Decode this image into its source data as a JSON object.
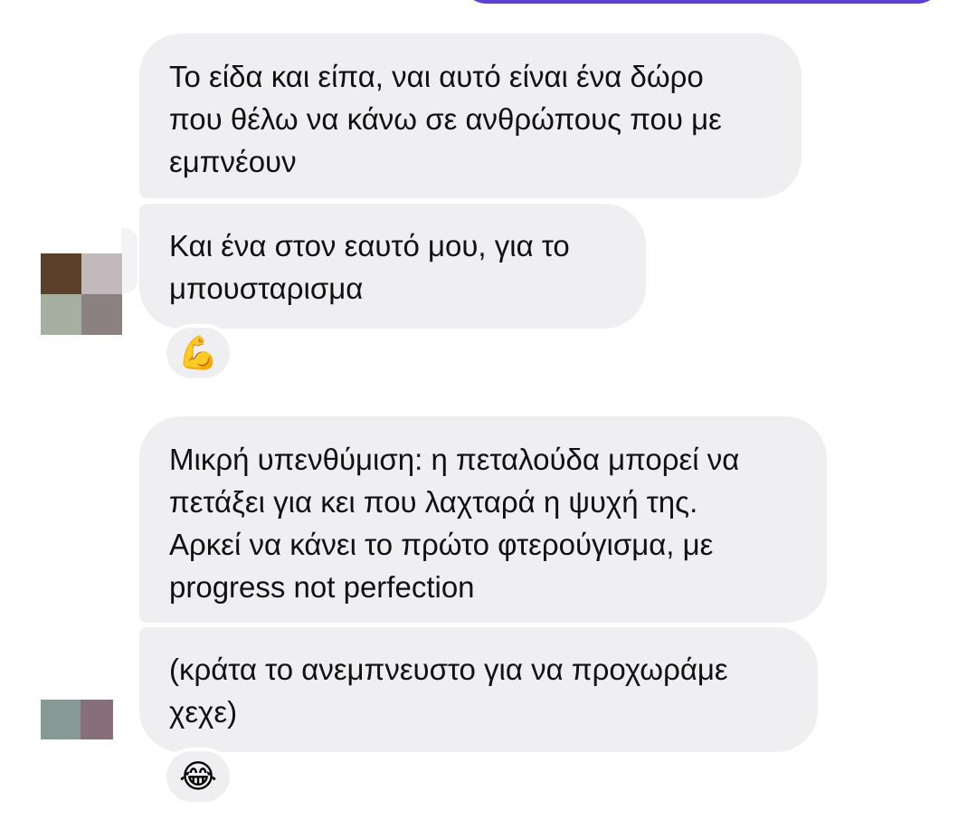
{
  "messages": [
    {
      "text": "Το είδα και είπα, ναι αυτό είναι ένα δώρο\nπου θέλω να κάνω σε ανθρώπους που με\nεμπνέουν"
    },
    {
      "text": "Και ένα στον εαυτό μου, για το\nμπουσταρισμα",
      "reaction": "💪"
    },
    {
      "text": "Μικρή υπενθύμιση: η πεταλούδα μπορεί να\nπετάξει για κει που λαχταρά η ψυχή της.\nΑρκεί να κάνει το πρώτο φτερούγισμα, με\nprogress not perfection"
    },
    {
      "text": "(κράτα το ανεμπνευστο για να προχωράμε\nχεχε)",
      "reaction": "😂"
    }
  ],
  "colors": {
    "bubble_received": "#efeff1",
    "sent_accent": "#5b3fd6",
    "avatar1": [
      "#5a3f2a",
      "#c2b9bd",
      "#a6b0a1",
      "#8c8080"
    ],
    "avatar2": [
      "#869994",
      "#866f7a"
    ]
  },
  "icons": {
    "avatar1": "pixelated-avatar",
    "avatar2": "pixelated-avatar"
  }
}
